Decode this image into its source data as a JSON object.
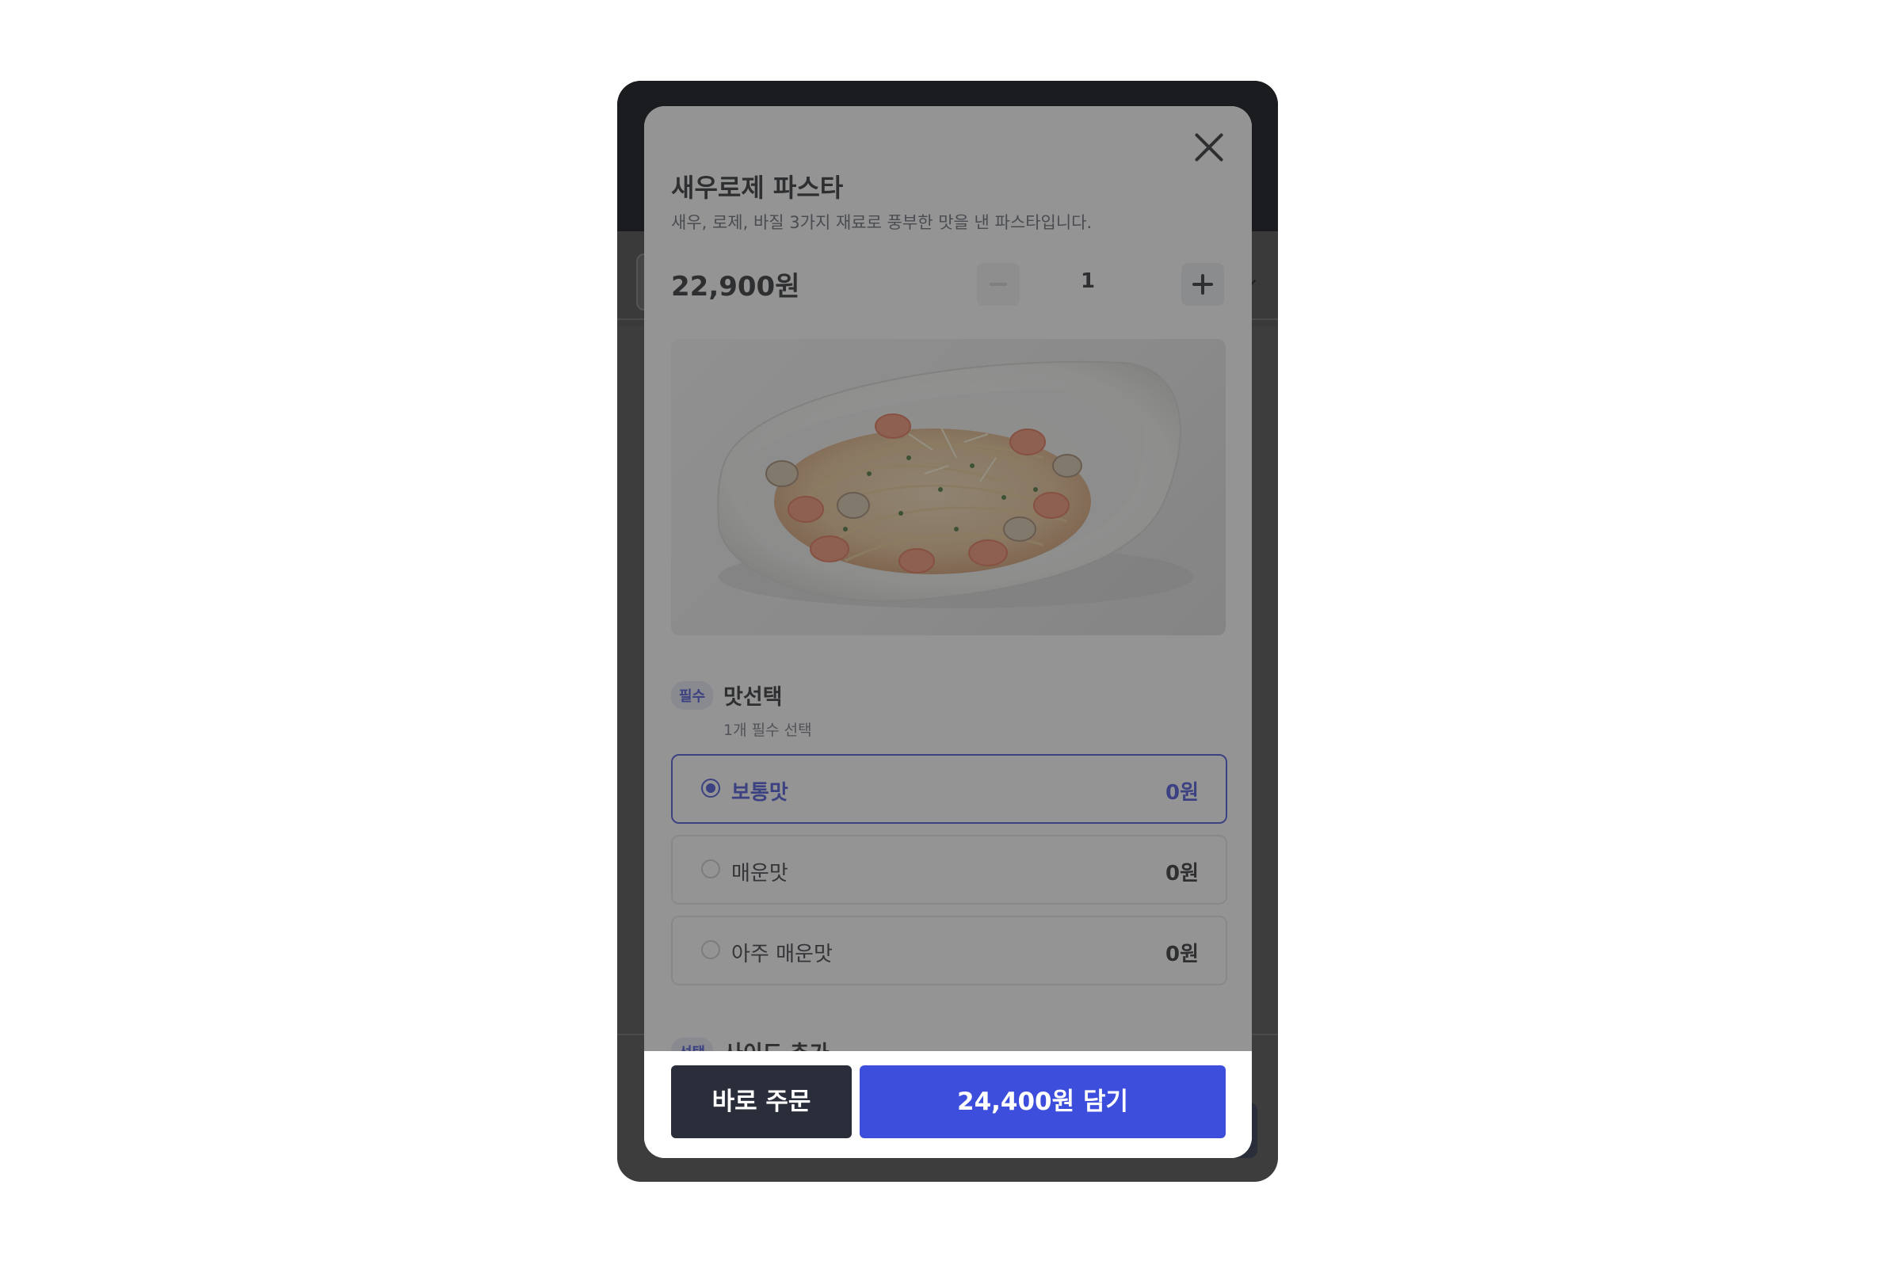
{
  "product": {
    "title": "새우로제 파스타",
    "description": "새우, 로제, 바질 3가지 재료로 풍부한 맛을 낸 파스타입니다.",
    "price": "22,900원",
    "quantity": "1",
    "image_alt": "shrimp-rose-pasta-photo"
  },
  "taste_section": {
    "badge": "필수",
    "title": "맛선택",
    "subtitle": "1개 필수 선택",
    "options": [
      {
        "label": "보통맛",
        "price": "0원",
        "selected": true
      },
      {
        "label": "매운맛",
        "price": "0원",
        "selected": false
      },
      {
        "label": "아주 매운맛",
        "price": "0원",
        "selected": false
      }
    ]
  },
  "side_section": {
    "badge": "선택",
    "title": "사이드 추가"
  },
  "footer": {
    "order_now": "바로 주문",
    "add_to_cart": "24,400원 담기"
  },
  "icons": {
    "close": "close-icon",
    "minus": "minus-icon",
    "plus": "plus-icon"
  },
  "colors": {
    "accent": "#3e4edc",
    "dark_button": "#2a2d3a",
    "overlay": "#3d3d3d"
  }
}
